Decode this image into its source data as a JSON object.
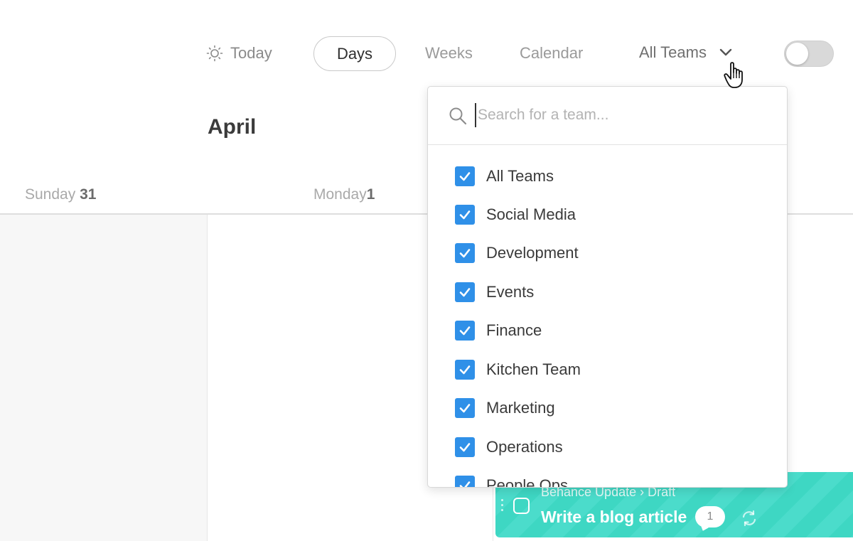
{
  "nav": {
    "today_label": "Today",
    "today_icon": "sun-icon",
    "views": [
      {
        "label": "Days",
        "active": true
      },
      {
        "label": "Weeks",
        "active": false
      },
      {
        "label": "Calendar",
        "active": false
      }
    ],
    "team_filter_label": "All Teams",
    "toggle_on": false
  },
  "calendar": {
    "month": "April",
    "days": [
      {
        "name": "Sunday",
        "number": "31"
      },
      {
        "name": "Monday",
        "number": "1"
      }
    ]
  },
  "team_dropdown": {
    "search_placeholder": "Search for a team...",
    "search_value": "",
    "teams": [
      {
        "label": "All Teams",
        "checked": true
      },
      {
        "label": "Social Media",
        "checked": true
      },
      {
        "label": "Development",
        "checked": true
      },
      {
        "label": "Events",
        "checked": true
      },
      {
        "label": "Finance",
        "checked": true
      },
      {
        "label": "Kitchen Team",
        "checked": true
      },
      {
        "label": "Marketing",
        "checked": true
      },
      {
        "label": "Operations",
        "checked": true
      },
      {
        "label": "People Ops",
        "checked": true
      }
    ]
  },
  "task": {
    "project": "Behance Update",
    "separator": "›",
    "status": "Draft",
    "title": "Write a blog article",
    "comment_count": "1"
  },
  "colors": {
    "checkbox": "#2f90e8",
    "task_bg": "#3ed7c3",
    "toggle_bg": "#d9d9d9"
  }
}
